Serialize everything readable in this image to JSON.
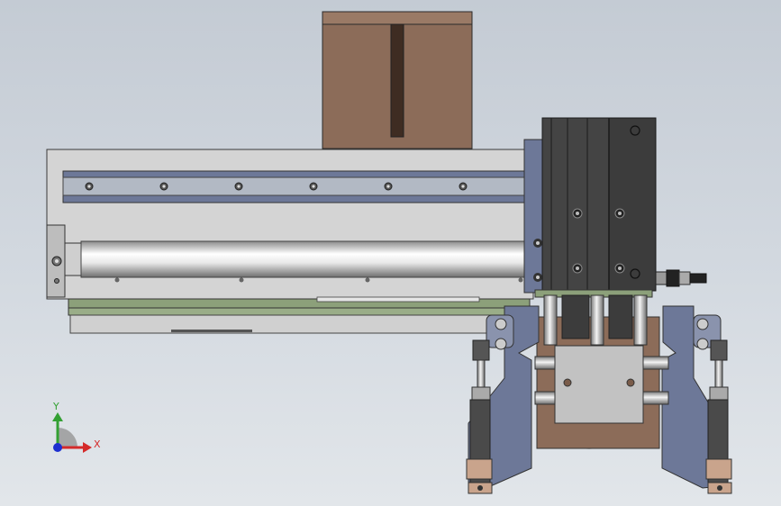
{
  "triad": {
    "y_label": "Y",
    "x_label": "X",
    "y_color": "#33a033",
    "x_color": "#d42a2a",
    "z_color": "#1d2fd0"
  },
  "colors": {
    "background_top": "#c4cbd4",
    "background_bottom": "#e2e6ea",
    "housing": "#d4d4d4",
    "rail": "#a9b0bc",
    "slider_blue": "#6d7898",
    "block_brown": "#8c6c59",
    "cylinder_dark": "#3c3c3c",
    "base_green": "#8ca07a"
  }
}
